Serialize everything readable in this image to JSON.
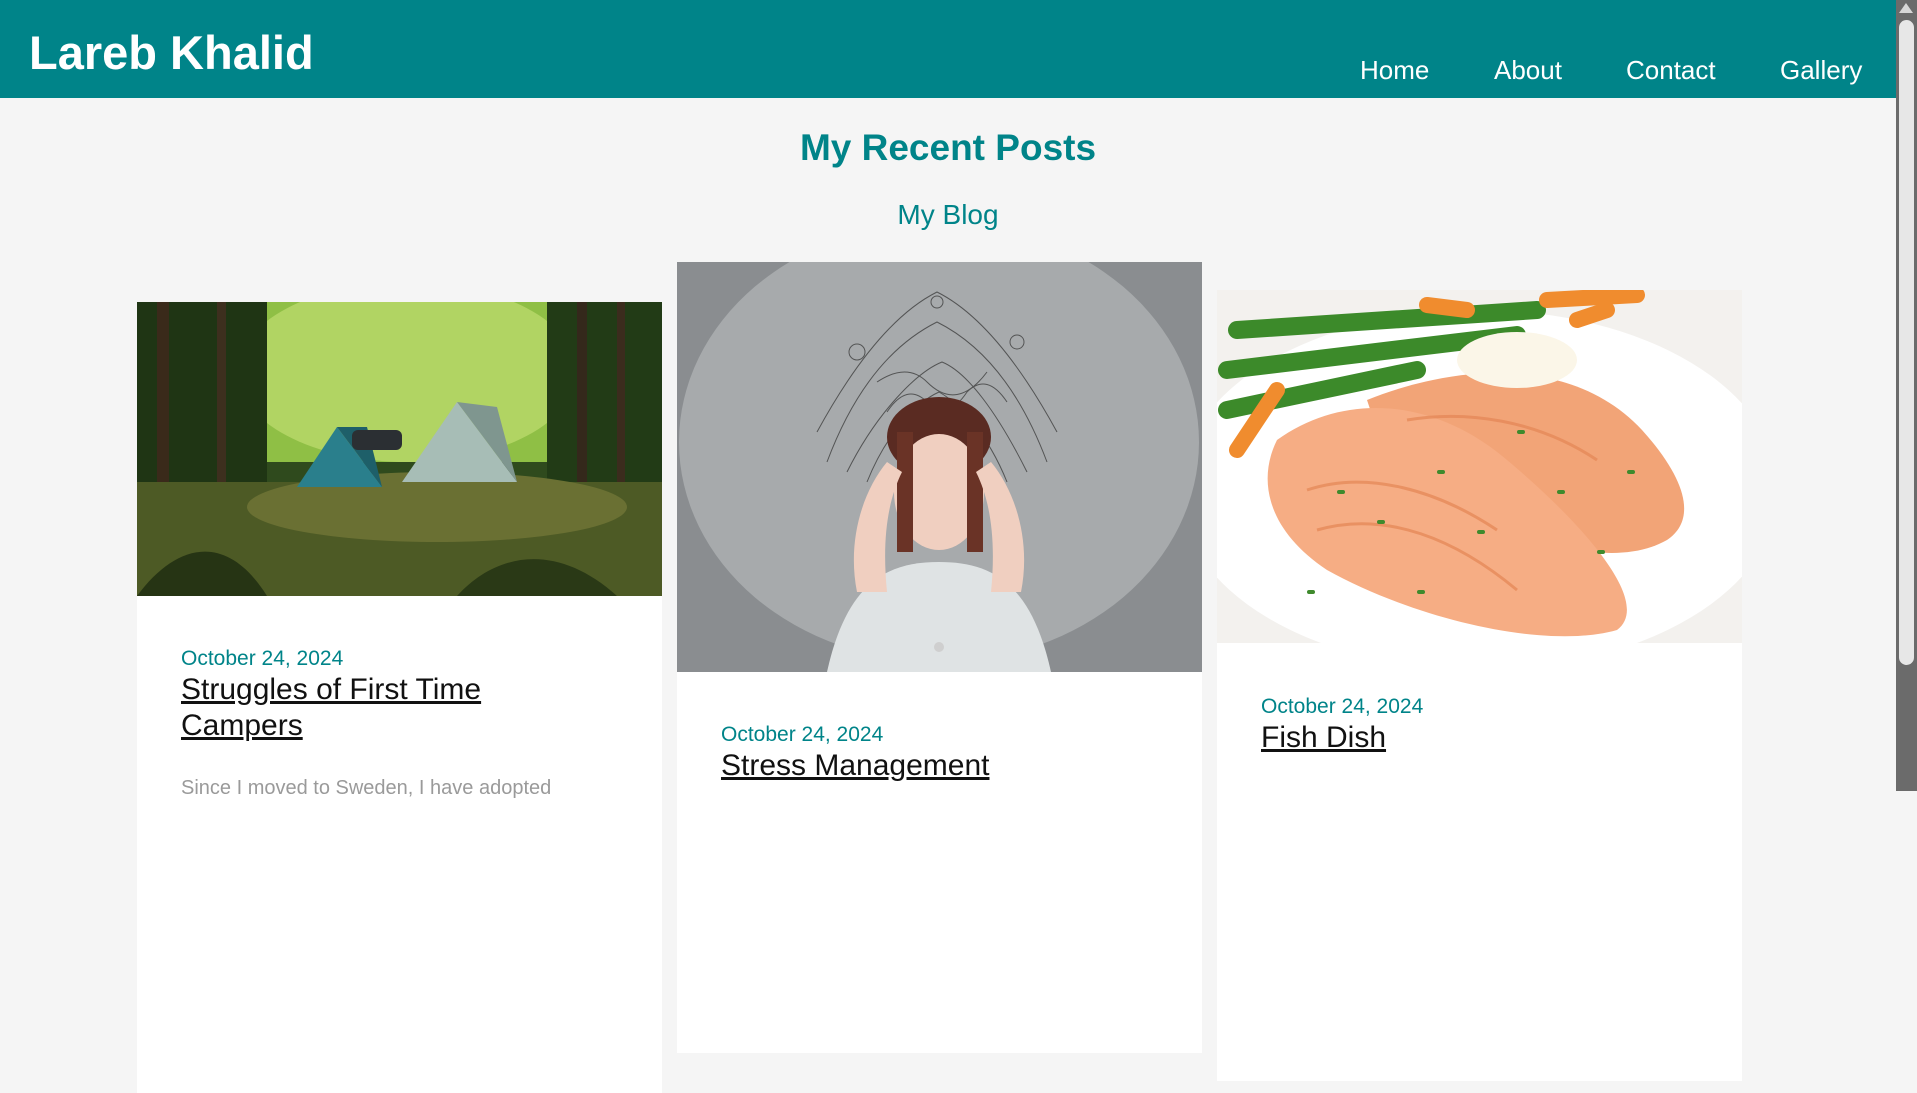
{
  "site": {
    "title": "Lareb Khalid"
  },
  "nav": {
    "items": [
      "Home",
      "About",
      "Contact",
      "Gallery"
    ]
  },
  "main": {
    "title": "My Recent Posts",
    "subtitle": "My Blog"
  },
  "posts": [
    {
      "date": "October 24, 2024",
      "title": "Struggles of First Time Campers",
      "excerpt": "Since I moved to Sweden, I have adopted"
    },
    {
      "date": "October 24, 2024",
      "title": "Stress Management",
      "excerpt": ""
    },
    {
      "date": "October 24, 2024",
      "title": "Fish Dish",
      "excerpt": ""
    }
  ],
  "colors": {
    "accent": "#008489",
    "background": "#f5f5f5",
    "card": "#ffffff"
  }
}
